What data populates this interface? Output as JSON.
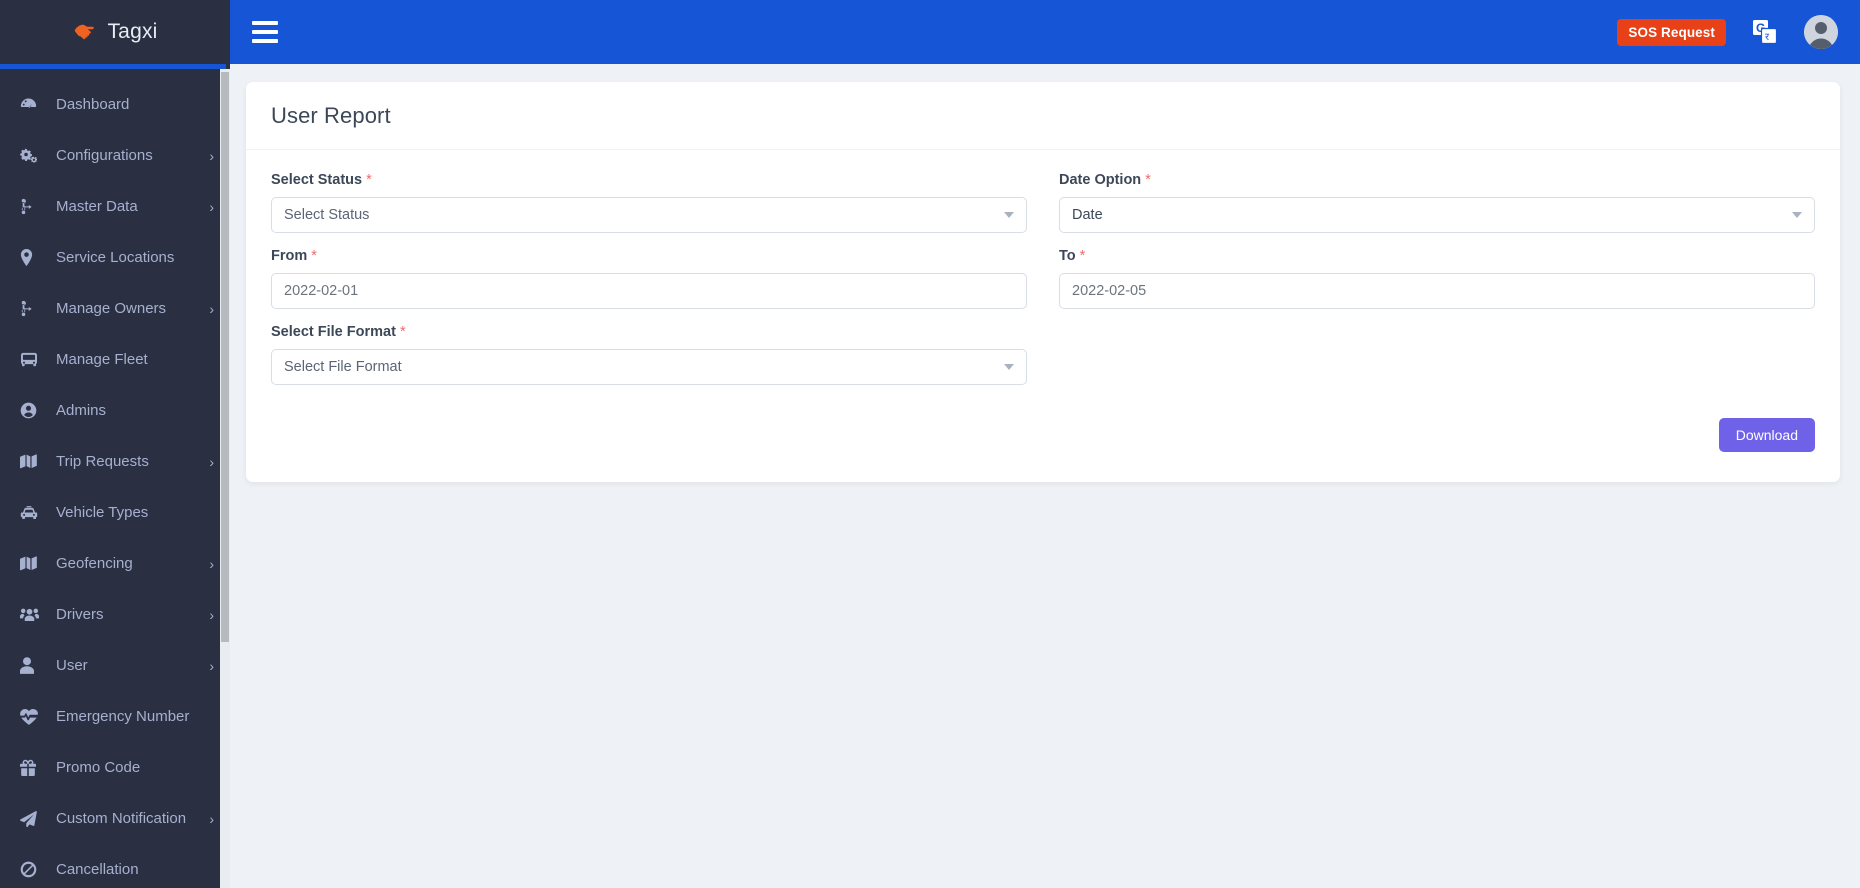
{
  "brand": {
    "name": "Tagxi",
    "logo_icon": "handshake-icon",
    "logo_color": "#ef6322"
  },
  "theme": {
    "sidebar_bg": "#2a3042",
    "topbar_bg": "#1555d6",
    "accent_purple": "#6f62e8",
    "sos_red": "#e84118",
    "required_red": "#f46a6a",
    "page_bg": "#eef1f5"
  },
  "sidebar": {
    "items": [
      {
        "label": "Dashboard",
        "icon": "dashboard-icon",
        "has_caret": false
      },
      {
        "label": "Configurations",
        "icon": "gears-icon",
        "has_caret": true
      },
      {
        "label": "Master Data",
        "icon": "sitemap-icon",
        "has_caret": true
      },
      {
        "label": "Service Locations",
        "icon": "map-pin-icon",
        "has_caret": false
      },
      {
        "label": "Manage Owners",
        "icon": "sitemap-icon",
        "has_caret": true
      },
      {
        "label": "Manage Fleet",
        "icon": "bus-icon",
        "has_caret": false
      },
      {
        "label": "Admins",
        "icon": "user-circle-icon",
        "has_caret": false
      },
      {
        "label": "Trip Requests",
        "icon": "map-icon",
        "has_caret": true
      },
      {
        "label": "Vehicle Types",
        "icon": "taxi-icon",
        "has_caret": false
      },
      {
        "label": "Geofencing",
        "icon": "map-icon",
        "has_caret": true
      },
      {
        "label": "Drivers",
        "icon": "users-icon",
        "has_caret": true
      },
      {
        "label": "User",
        "icon": "user-icon",
        "has_caret": true
      },
      {
        "label": "Emergency Number",
        "icon": "heartbeat-icon",
        "has_caret": false
      },
      {
        "label": "Promo Code",
        "icon": "gift-icon",
        "has_caret": false
      },
      {
        "label": "Custom Notification",
        "icon": "paper-plane-icon",
        "has_caret": true
      },
      {
        "label": "Cancellation",
        "icon": "ban-icon",
        "has_caret": false
      }
    ]
  },
  "topbar": {
    "menu_toggle_icon": "hamburger-icon",
    "sos_label": "SOS Request",
    "translate_icon": "google-translate-icon",
    "avatar_icon": "user-avatar-icon"
  },
  "page": {
    "title": "User Report"
  },
  "form": {
    "fields": [
      {
        "name": "select-status",
        "label": "Select Status",
        "required": true,
        "type": "select",
        "value": "",
        "placeholder": "Select Status"
      },
      {
        "name": "date-option",
        "label": "Date Option",
        "required": true,
        "type": "select",
        "value": "Date",
        "placeholder": "Date"
      },
      {
        "name": "from-date",
        "label": "From",
        "required": true,
        "type": "text",
        "value": "2022-02-01",
        "placeholder": "2022-02-01"
      },
      {
        "name": "to-date",
        "label": "To",
        "required": true,
        "type": "text",
        "value": "2022-02-05",
        "placeholder": "2022-02-05"
      },
      {
        "name": "select-file-format",
        "label": "Select File Format",
        "required": true,
        "type": "select",
        "value": "",
        "placeholder": "Select File Format"
      }
    ],
    "required_marker": "*",
    "download_label": "Download"
  }
}
